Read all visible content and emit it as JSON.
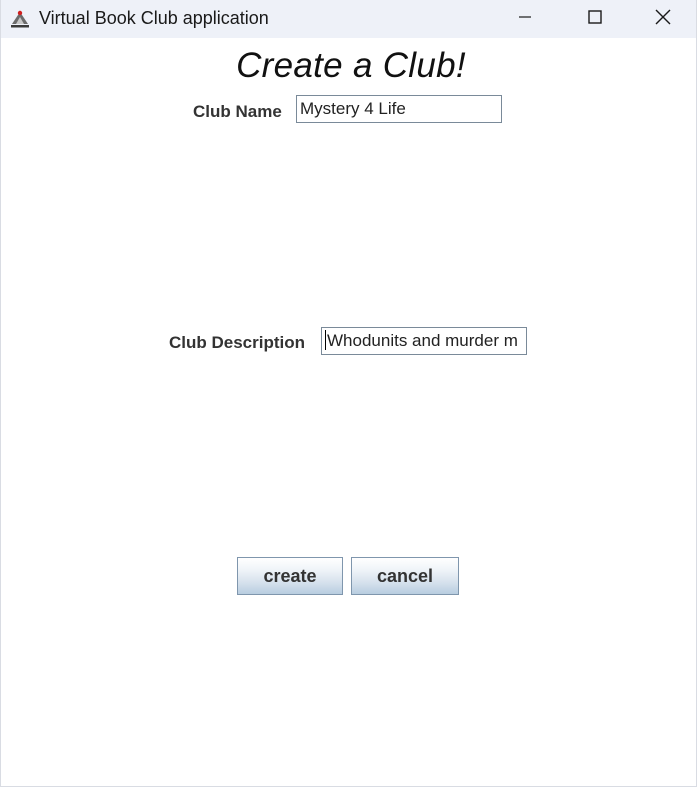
{
  "window": {
    "title": "Virtual Book Club application"
  },
  "form": {
    "heading": "Create a Club!",
    "club_name_label": "Club Name",
    "club_name_value": "Mystery 4 Life",
    "club_description_label": "Club Description",
    "club_description_value": "Whodunits and murder m"
  },
  "buttons": {
    "create_label": "create",
    "cancel_label": "cancel"
  },
  "icons": {
    "app": "java-cup-icon",
    "minimize": "minimize-icon",
    "maximize": "maximize-icon",
    "close": "close-icon"
  },
  "colors": {
    "titlebar": "#eef1f8",
    "button_gradient_top": "#ffffff",
    "button_gradient_bottom": "#b8cde0",
    "field_border": "#7a8a99"
  }
}
